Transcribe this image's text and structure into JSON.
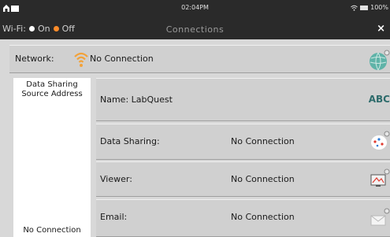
{
  "status": {
    "time": "02:04PM",
    "battery": "100%"
  },
  "header": {
    "wifi_label": "Wi-Fi:",
    "wifi_on": "On",
    "wifi_off": "Off",
    "title": "Connections",
    "close": "×"
  },
  "network": {
    "label": "Network:",
    "value": "No Connection"
  },
  "left_panel": {
    "title_line1": "Data Sharing",
    "title_line2": "Source Address",
    "bottom": "No Connection"
  },
  "rows": [
    {
      "label": "Name: LabQuest",
      "value": "",
      "action": "ABC"
    },
    {
      "label": "Data Sharing:",
      "value": "No Connection"
    },
    {
      "label": "Viewer:",
      "value": "No Connection"
    },
    {
      "label": "Email:",
      "value": "No Connection"
    }
  ],
  "colors": {
    "header_bg": "#2a2a2a",
    "accent_orange": "#ff8c2a",
    "abc_teal": "#2d6b6b"
  }
}
